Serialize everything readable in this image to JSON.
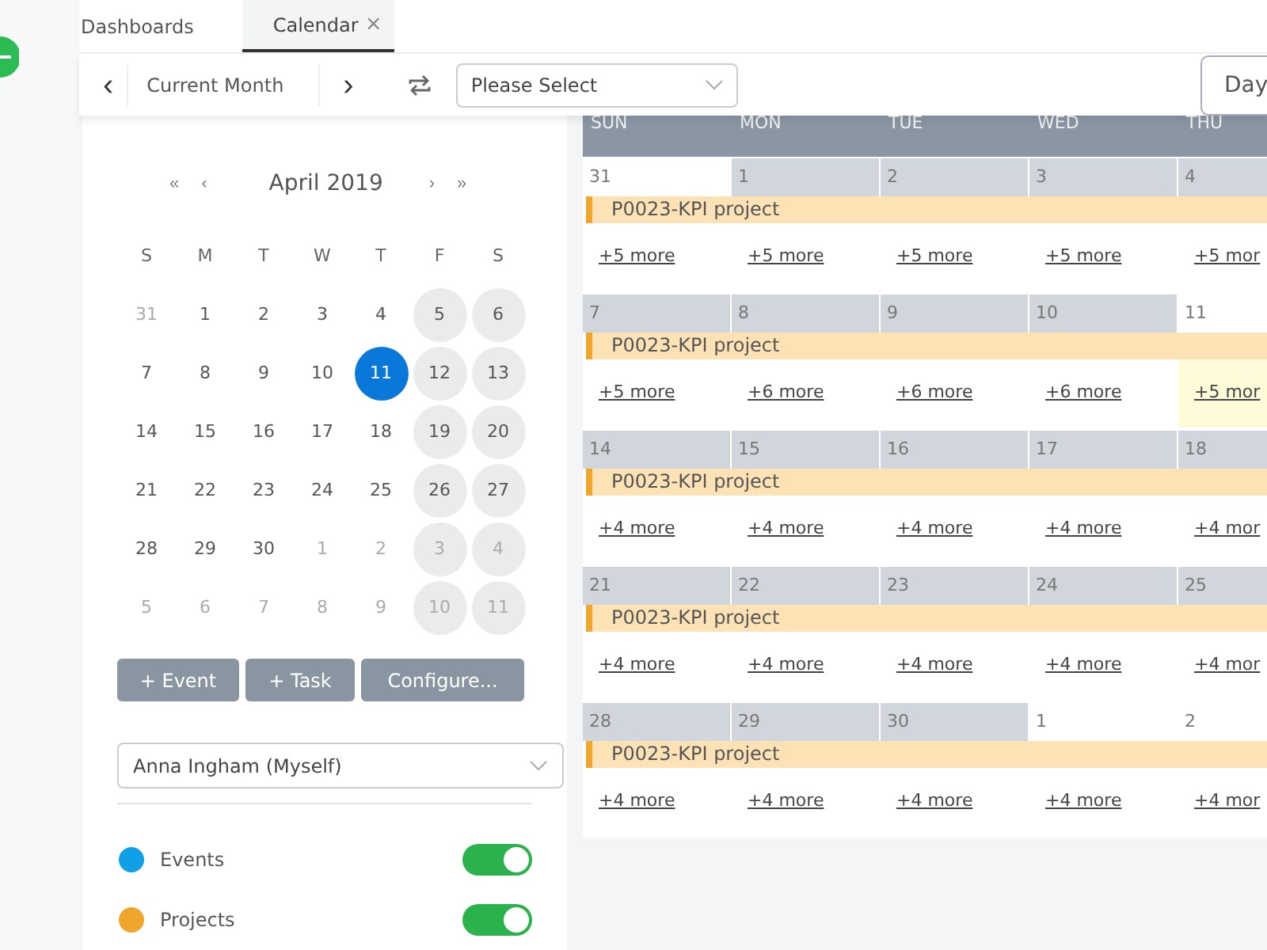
{
  "tabs": [
    {
      "label": "Dashboards",
      "selected": false
    },
    {
      "label": "Calendar",
      "selected": true,
      "close": "×"
    }
  ],
  "toolbar": {
    "prev": "‹",
    "period": "Current Month",
    "next": "›",
    "select_placeholder": "Please Select",
    "view_button": "Day"
  },
  "mini_calendar": {
    "title": "April 2019",
    "nav": [
      "«",
      "‹",
      "›",
      "»"
    ],
    "weekdays": [
      "S",
      "M",
      "T",
      "W",
      "T",
      "F",
      "S"
    ],
    "days": [
      {
        "label": "31",
        "muted": true,
        "weekend": false,
        "selected": false
      },
      {
        "label": "1",
        "muted": false,
        "weekend": false,
        "selected": false
      },
      {
        "label": "2",
        "muted": false,
        "weekend": false,
        "selected": false
      },
      {
        "label": "3",
        "muted": false,
        "weekend": false,
        "selected": false
      },
      {
        "label": "4",
        "muted": false,
        "weekend": false,
        "selected": false
      },
      {
        "label": "5",
        "muted": false,
        "weekend": true,
        "selected": false
      },
      {
        "label": "6",
        "muted": false,
        "weekend": true,
        "selected": false
      },
      {
        "label": "7",
        "muted": false,
        "weekend": false,
        "selected": false
      },
      {
        "label": "8",
        "muted": false,
        "weekend": false,
        "selected": false
      },
      {
        "label": "9",
        "muted": false,
        "weekend": false,
        "selected": false
      },
      {
        "label": "10",
        "muted": false,
        "weekend": false,
        "selected": false
      },
      {
        "label": "11",
        "muted": false,
        "weekend": false,
        "selected": true
      },
      {
        "label": "12",
        "muted": false,
        "weekend": true,
        "selected": false
      },
      {
        "label": "13",
        "muted": false,
        "weekend": true,
        "selected": false
      },
      {
        "label": "14",
        "muted": false,
        "weekend": false,
        "selected": false
      },
      {
        "label": "15",
        "muted": false,
        "weekend": false,
        "selected": false
      },
      {
        "label": "16",
        "muted": false,
        "weekend": false,
        "selected": false
      },
      {
        "label": "17",
        "muted": false,
        "weekend": false,
        "selected": false
      },
      {
        "label": "18",
        "muted": false,
        "weekend": false,
        "selected": false
      },
      {
        "label": "19",
        "muted": false,
        "weekend": true,
        "selected": false
      },
      {
        "label": "20",
        "muted": false,
        "weekend": true,
        "selected": false
      },
      {
        "label": "21",
        "muted": false,
        "weekend": false,
        "selected": false
      },
      {
        "label": "22",
        "muted": false,
        "weekend": false,
        "selected": false
      },
      {
        "label": "23",
        "muted": false,
        "weekend": false,
        "selected": false
      },
      {
        "label": "24",
        "muted": false,
        "weekend": false,
        "selected": false
      },
      {
        "label": "25",
        "muted": false,
        "weekend": false,
        "selected": false
      },
      {
        "label": "26",
        "muted": false,
        "weekend": true,
        "selected": false
      },
      {
        "label": "27",
        "muted": false,
        "weekend": true,
        "selected": false
      },
      {
        "label": "28",
        "muted": false,
        "weekend": false,
        "selected": false
      },
      {
        "label": "29",
        "muted": false,
        "weekend": false,
        "selected": false
      },
      {
        "label": "30",
        "muted": false,
        "weekend": false,
        "selected": false
      },
      {
        "label": "1",
        "muted": true,
        "weekend": false,
        "selected": false
      },
      {
        "label": "2",
        "muted": true,
        "weekend": false,
        "selected": false
      },
      {
        "label": "3",
        "muted": true,
        "weekend": true,
        "selected": false
      },
      {
        "label": "4",
        "muted": true,
        "weekend": true,
        "selected": false
      },
      {
        "label": "5",
        "muted": true,
        "weekend": false,
        "selected": false
      },
      {
        "label": "6",
        "muted": true,
        "weekend": false,
        "selected": false
      },
      {
        "label": "7",
        "muted": true,
        "weekend": false,
        "selected": false
      },
      {
        "label": "8",
        "muted": true,
        "weekend": false,
        "selected": false
      },
      {
        "label": "9",
        "muted": true,
        "weekend": false,
        "selected": false
      },
      {
        "label": "10",
        "muted": true,
        "weekend": true,
        "selected": false
      },
      {
        "label": "11",
        "muted": true,
        "weekend": true,
        "selected": false
      }
    ]
  },
  "actions": [
    "+ Event",
    "+ Task",
    "Configure..."
  ],
  "user_select": "Anna Ingham (Myself)",
  "layers": [
    {
      "label": "Events",
      "color": "#0fa0e8",
      "on": true
    },
    {
      "label": "Projects",
      "color": "#f0a52c",
      "on": true
    }
  ],
  "month_view": {
    "columns": [
      "SUN",
      "MON",
      "TUE",
      "WED",
      "THU"
    ],
    "weeks": [
      {
        "project": "P0023-KPI project",
        "days": [
          {
            "date": "31",
            "in_month": false,
            "today": false,
            "more": "+5 more"
          },
          {
            "date": "1",
            "in_month": true,
            "today": false,
            "more": "+5 more"
          },
          {
            "date": "2",
            "in_month": true,
            "today": false,
            "more": "+5 more"
          },
          {
            "date": "3",
            "in_month": true,
            "today": false,
            "more": "+5 more"
          },
          {
            "date": "4",
            "in_month": true,
            "today": false,
            "more": "+5 mor"
          }
        ]
      },
      {
        "project": "P0023-KPI project",
        "days": [
          {
            "date": "7",
            "in_month": true,
            "today": false,
            "more": "+5 more"
          },
          {
            "date": "8",
            "in_month": true,
            "today": false,
            "more": "+6 more"
          },
          {
            "date": "9",
            "in_month": true,
            "today": false,
            "more": "+6 more"
          },
          {
            "date": "10",
            "in_month": true,
            "today": false,
            "more": "+6 more"
          },
          {
            "date": "11",
            "in_month": true,
            "today": true,
            "more": "+5 mor"
          }
        ]
      },
      {
        "project": "P0023-KPI project",
        "days": [
          {
            "date": "14",
            "in_month": true,
            "today": false,
            "more": "+4 more"
          },
          {
            "date": "15",
            "in_month": true,
            "today": false,
            "more": "+4 more"
          },
          {
            "date": "16",
            "in_month": true,
            "today": false,
            "more": "+4 more"
          },
          {
            "date": "17",
            "in_month": true,
            "today": false,
            "more": "+4 more"
          },
          {
            "date": "18",
            "in_month": true,
            "today": false,
            "more": "+4 mor"
          }
        ]
      },
      {
        "project": "P0023-KPI project",
        "days": [
          {
            "date": "21",
            "in_month": true,
            "today": false,
            "more": "+4 more"
          },
          {
            "date": "22",
            "in_month": true,
            "today": false,
            "more": "+4 more"
          },
          {
            "date": "23",
            "in_month": true,
            "today": false,
            "more": "+4 more"
          },
          {
            "date": "24",
            "in_month": true,
            "today": false,
            "more": "+4 more"
          },
          {
            "date": "25",
            "in_month": true,
            "today": false,
            "more": "+4 mor"
          }
        ]
      },
      {
        "project": "P0023-KPI project",
        "days": [
          {
            "date": "28",
            "in_month": true,
            "today": false,
            "more": "+4 more"
          },
          {
            "date": "29",
            "in_month": true,
            "today": false,
            "more": "+4 more"
          },
          {
            "date": "30",
            "in_month": true,
            "today": false,
            "more": "+4 more"
          },
          {
            "date": "1",
            "in_month": false,
            "today": false,
            "more": "+4 more"
          },
          {
            "date": "2",
            "in_month": false,
            "today": false,
            "more": "+4 mor"
          }
        ]
      }
    ]
  }
}
